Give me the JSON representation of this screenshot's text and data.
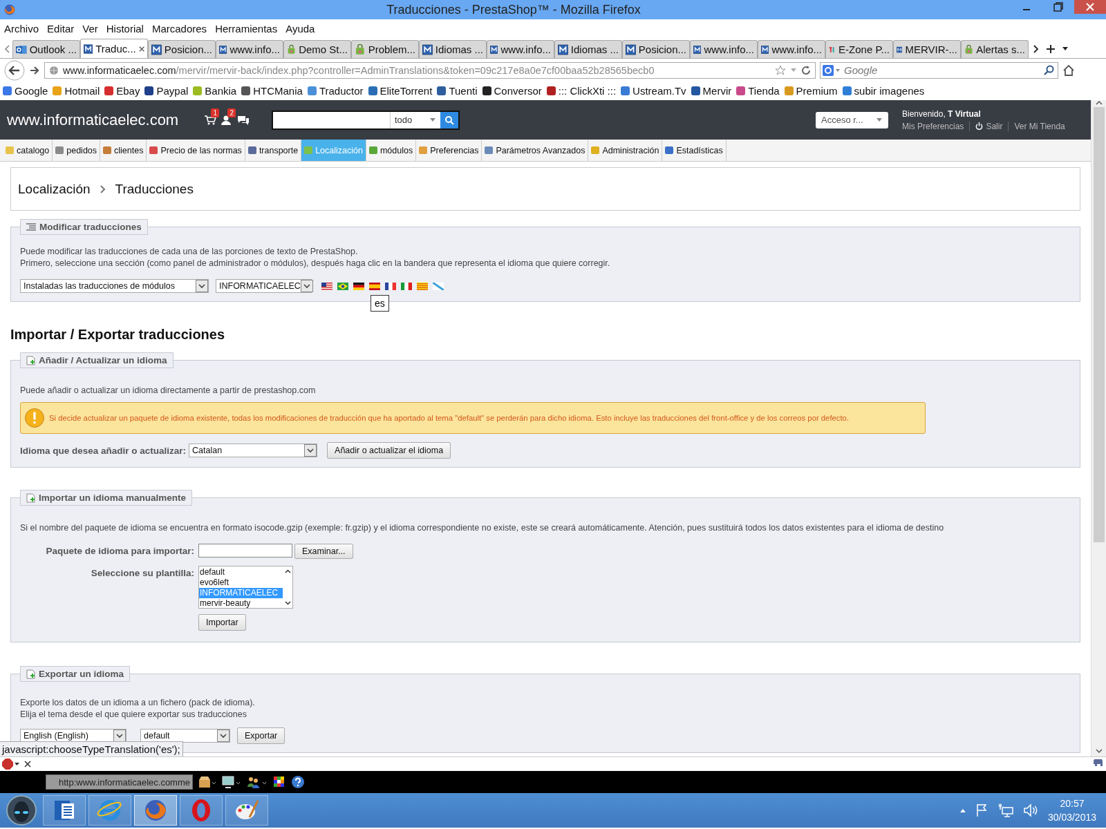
{
  "window": {
    "title": "Traducciones - PrestaShop™ - Mozilla Firefox"
  },
  "menu_bar": [
    "Archivo",
    "Editar",
    "Ver",
    "Historial",
    "Marcadores",
    "Herramientas",
    "Ayuda"
  ],
  "tabs": [
    {
      "label": "Outlook ...",
      "kind": "outlook",
      "selected": false
    },
    {
      "label": "Traduc...",
      "kind": "m",
      "selected": true
    },
    {
      "label": "Posicion...",
      "kind": "m",
      "selected": false
    },
    {
      "label": "www.info...",
      "kind": "m",
      "selected": false
    },
    {
      "label": "Demo St...",
      "kind": "shop",
      "selected": false
    },
    {
      "label": "Problem...",
      "kind": "shop",
      "selected": false
    },
    {
      "label": "Idiomas ...",
      "kind": "m",
      "selected": false
    },
    {
      "label": "www.info...",
      "kind": "m",
      "selected": false
    },
    {
      "label": "Idiomas ...",
      "kind": "m",
      "selected": false
    },
    {
      "label": "Posicion...",
      "kind": "m",
      "selected": false
    },
    {
      "label": "www.info...",
      "kind": "m",
      "selected": false
    },
    {
      "label": "www.info...",
      "kind": "m",
      "selected": false
    },
    {
      "label": "E-Zone P...",
      "kind": "tm",
      "selected": false
    },
    {
      "label": "MERVIR-...",
      "kind": "m",
      "selected": false
    },
    {
      "label": "Alertas s...",
      "kind": "shop",
      "selected": false
    }
  ],
  "address": {
    "domain": "www.informaticaelec.com",
    "path": "/mervir/mervir-back/index.php?controller=AdminTranslations&token=09c217e8a0e7cf00baa52b28565becb0"
  },
  "web_search": {
    "placeholder": "Google"
  },
  "bookmarks": [
    {
      "label": "Google",
      "color": "#3b78e7"
    },
    {
      "label": "Hotmail",
      "color": "#e8a317"
    },
    {
      "label": "Ebay",
      "color": "#d62e2e"
    },
    {
      "label": "Paypal",
      "color": "#1f3f8a"
    },
    {
      "label": "Bankia",
      "color": "#9bbb20"
    },
    {
      "label": "HTCMania",
      "color": "#555555"
    },
    {
      "label": "Traductor",
      "color": "#4a90d9"
    },
    {
      "label": "EliteTorrent",
      "color": "#2a6fb5"
    },
    {
      "label": "Tuenti",
      "color": "#2f5f9e"
    },
    {
      "label": "Conversor",
      "color": "#222222"
    },
    {
      "label": "::: ClickXti :::",
      "color": "#b02020"
    },
    {
      "label": "Ustream.Tv",
      "color": "#3a7bd5"
    },
    {
      "label": "Mervir",
      "color": "#2357a0"
    },
    {
      "label": "Tienda",
      "color": "#c84a8a"
    },
    {
      "label": "Premium",
      "color": "#d89a1e"
    },
    {
      "label": "subir imagenes",
      "color": "#2f7fd6"
    }
  ],
  "admin_header": {
    "shop_name": "www.informaticaelec.com",
    "notifications": [
      {
        "kind": "cart",
        "badge": "1"
      },
      {
        "kind": "customer",
        "badge": "2"
      },
      {
        "kind": "message"
      }
    ],
    "search_scope": "todo",
    "quick_access": "Acceso r...",
    "welcome": "Bienvenido, **T Virtual**",
    "links": [
      {
        "label": "Mis Preferencias",
        "kind": "plain"
      },
      {
        "label": "Salir",
        "kind": "power"
      },
      {
        "label": "Ver Mi Tienda",
        "kind": "plain"
      }
    ]
  },
  "nav": [
    {
      "label": "catalogo",
      "color": "#e8c34a",
      "selected": false
    },
    {
      "label": "pedidos",
      "color": "#8a8a8a",
      "selected": false
    },
    {
      "label": "clientes",
      "color": "#c77d3a",
      "selected": false
    },
    {
      "label": "Precio de las normas",
      "color": "#d84a4a",
      "selected": false
    },
    {
      "label": "transporte",
      "color": "#5a6a9a",
      "selected": false
    },
    {
      "label": "Localización",
      "color": "#7cc04a",
      "selected": true
    },
    {
      "label": "módulos",
      "color": "#5aa83a",
      "selected": false
    },
    {
      "label": "Preferencias",
      "color": "#e0a040",
      "selected": false
    },
    {
      "label": "Parámetros Avanzados",
      "color": "#6a8ab8",
      "selected": false
    },
    {
      "label": "Administración",
      "color": "#e0b020",
      "selected": false
    },
    {
      "label": "Estadísticas",
      "color": "#3a70c8",
      "selected": false
    }
  ],
  "breadcrumb": [
    "Localización",
    "Traducciones"
  ],
  "modify_section": {
    "legend": "Modificar traducciones",
    "text": [
      "Puede modificar las traducciones de cada una de las porciones de texto de PrestaShop.",
      "Primero, seleccione una sección (como panel de administrador o módulos), después haga clic en la bandera que representa el idioma que quiere corregir."
    ],
    "type_select": "Instaladas las traducciones de módulos",
    "theme_select": "INFORMATICAELEC",
    "flags": [
      {
        "kind": "us"
      },
      {
        "kind": "br"
      },
      {
        "kind": "de"
      },
      {
        "kind": "es",
        "tooltip": "es"
      },
      {
        "kind": "fr"
      },
      {
        "kind": "it"
      },
      {
        "kind": "ca"
      },
      {
        "kind": "gl"
      }
    ]
  },
  "import_export_heading": "Importar / Exportar traducciones",
  "add_section": {
    "legend": "Añadir / Actualizar un idioma",
    "text": "Puede añadir o actualizar un idioma directamente a partir de prestashop.com",
    "warning": "Si decide actualizar un paquete de idioma existente, todas los modificaciones de traducción que ha aportado al tema \"default\" se perderán para dicho idioma. Esto incluye las traducciones del front-office y de los correos por defecto.",
    "label": "Idioma que desea añadir o actualizar:",
    "select": "Catalan",
    "button": "Añadir o actualizar el idioma"
  },
  "manual_section": {
    "legend": "Importar un idioma manualmente",
    "text": "Si el nombre del paquete de idioma se encuentra en formato isocode.gzip (exemple: fr.gzip) y el idioma correspondiente no existe, este se creará automáticamente. Atención, pues sustituirá todos los datos existentes para el idioma de destino",
    "file_label": "Paquete de idioma para importar:",
    "browse_button": "Examinar...",
    "template_label": "Seleccione su plantilla:",
    "templates": [
      {
        "label": "default",
        "selected": false
      },
      {
        "label": "evo6left",
        "selected": false
      },
      {
        "label": "INFORMATICAELEC",
        "selected": true
      },
      {
        "label": "mervir-beauty",
        "selected": false
      }
    ],
    "button": "Importar"
  },
  "export_section": {
    "legend": "Exportar un idioma",
    "text": [
      "Exporte los datos de un idioma a un fichero (pack de idioma).",
      "Elija el tema desde el que quiere exportar sus traducciones"
    ],
    "language_select": "English (English)",
    "theme_select": "default",
    "button": "Exportar"
  },
  "status_bar": "javascript:chooseTypeTranslation('es');",
  "toolbar_field": "http:www.informaticaelec.comme",
  "taskbar": {
    "apps": [
      {
        "kind": "word",
        "selected": false
      },
      {
        "kind": "ie",
        "selected": false
      },
      {
        "kind": "firefox",
        "selected": true
      },
      {
        "kind": "opera",
        "selected": false
      },
      {
        "kind": "paint",
        "selected": false
      }
    ],
    "time": "20:57",
    "date": "30/03/2013"
  }
}
